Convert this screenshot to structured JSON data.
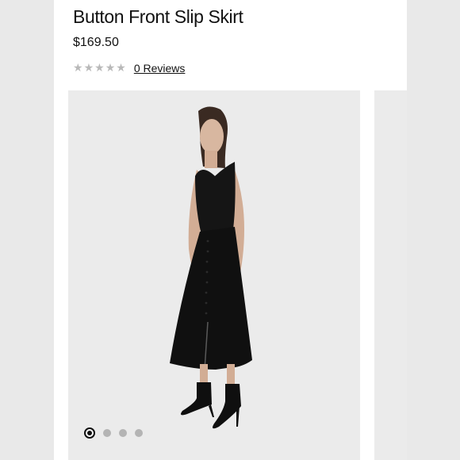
{
  "product": {
    "title": "Button Front Slip Skirt",
    "price": "$169.50",
    "rating": 0,
    "rating_max": 5,
    "star_icon": "star-icon",
    "star_color": "#b9b9b9",
    "reviews_label": "0 Reviews"
  },
  "gallery": {
    "image_description": "Model wearing black satin camisole and black button front slip skirt with black pointed ankle boots",
    "background_color": "#ebebeb",
    "page_count": 4,
    "active_index": 0
  }
}
